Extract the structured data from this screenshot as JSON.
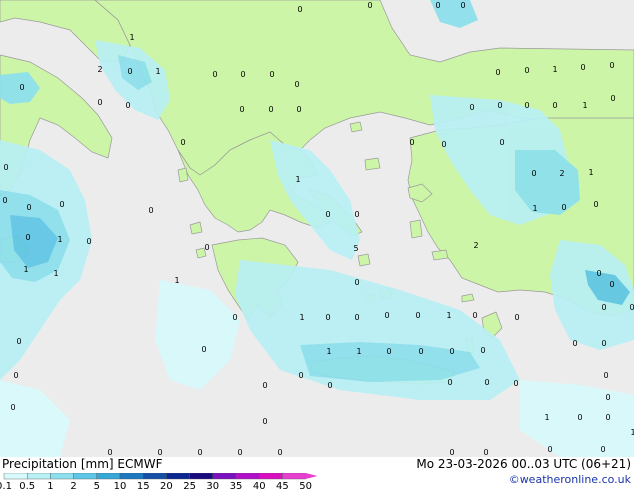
{
  "title": "Precipitation [mm]",
  "model": "ECMWF",
  "datetime": "Mo 23-03-2026 00..03 UTC (06+21)",
  "credit": "©weatheronline.co.uk",
  "colors": {
    "sea": "#ececec",
    "land": "#ccf5a7",
    "precip_light": "#b8f0f4",
    "precip_mid": "#8ce0ee",
    "precip_heavy": "#5ec6e6",
    "coast": "#9a9a9a"
  },
  "legend": {
    "ticks": [
      "0.1",
      "0.5",
      "1",
      "2",
      "5",
      "10",
      "15",
      "20",
      "25",
      "30",
      "35",
      "40",
      "45",
      "50"
    ],
    "colors": [
      "#d8fafc",
      "#b8f0f4",
      "#8ce0ee",
      "#5ec6e6",
      "#36a8d8",
      "#1d78c0",
      "#1450a8",
      "#0a2890",
      "#1a0a80",
      "#7a10c0",
      "#b010c8",
      "#d810c0",
      "#e840d0"
    ]
  },
  "values": [
    "0",
    "0",
    "0",
    "0",
    "1",
    "2",
    "0",
    "1",
    "0",
    "0",
    "0",
    "0",
    "0",
    "0",
    "1",
    "0",
    "0",
    "0",
    "0",
    "0",
    "0",
    "0",
    "0",
    "0",
    "0",
    "0",
    "0",
    "0",
    "1",
    "0",
    "0",
    "0",
    "0",
    "0",
    "1",
    "0",
    "2",
    "1",
    "0",
    "0",
    "0",
    "0",
    "0",
    "0",
    "1",
    "0",
    "0",
    "0",
    "1",
    "0",
    "0",
    "5",
    "2",
    "1",
    "1",
    "1",
    "0",
    "0",
    "0",
    "0",
    "1",
    "0",
    "0",
    "0",
    "0",
    "1",
    "0",
    "0",
    "0",
    "0",
    "0",
    "0",
    "1",
    "1",
    "0",
    "0",
    "0",
    "0",
    "0",
    "0",
    "0",
    "0",
    "0",
    "0",
    "0",
    "0",
    "0",
    "0",
    "0",
    "1",
    "0",
    "0",
    "0",
    "0",
    "0",
    "0",
    "0",
    "0",
    "1",
    "0",
    "0",
    "0",
    "0",
    "0",
    "0",
    "0",
    "0",
    "0",
    "0",
    "0",
    "0",
    "0"
  ]
}
